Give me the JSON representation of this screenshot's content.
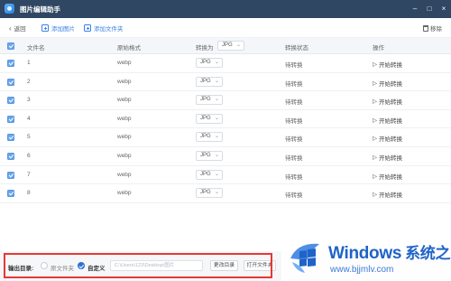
{
  "window": {
    "title": "图片编辑助手",
    "controls": [
      "–",
      "□",
      "×"
    ]
  },
  "toolbar": {
    "back_label": "返回",
    "add_image_label": "添加图片",
    "add_folder_label": "添加文件夹",
    "delete_label": "移除"
  },
  "table": {
    "headers": {
      "filename": "文件名",
      "original_format": "原始格式",
      "convert_to": "转换为",
      "convert_to_value": "JPG",
      "status": "转换状态",
      "action": "操作"
    },
    "rows": [
      {
        "name": "1",
        "format": "webp",
        "target": "JPG",
        "status": "待转换",
        "action": "开始转换"
      },
      {
        "name": "2",
        "format": "webp",
        "target": "JPG",
        "status": "待转换",
        "action": "开始转换"
      },
      {
        "name": "3",
        "format": "webp",
        "target": "JPG",
        "status": "待转换",
        "action": "开始转换"
      },
      {
        "name": "4",
        "format": "webp",
        "target": "JPG",
        "status": "待转换",
        "action": "开始转换"
      },
      {
        "name": "5",
        "format": "webp",
        "target": "JPG",
        "status": "待转换",
        "action": "开始转换"
      },
      {
        "name": "6",
        "format": "webp",
        "target": "JPG",
        "status": "待转换",
        "action": "开始转换"
      },
      {
        "name": "7",
        "format": "webp",
        "target": "JPG",
        "status": "待转换",
        "action": "开始转换"
      },
      {
        "name": "8",
        "format": "webp",
        "target": "JPG",
        "status": "待转换",
        "action": "开始转换"
      }
    ]
  },
  "output": {
    "label": "输出目录:",
    "option_original": "原文件夹",
    "option_custom": "自定义",
    "selected": "custom",
    "path_value": "C:\\Users\\123\\Desktop\\图片",
    "change_dir_label": "更改目录",
    "open_folder_label": "打开文件夹"
  },
  "watermark": {
    "brand": "Windows",
    "brand_cn": "系统之家",
    "url": "www.bjjmlv.com"
  },
  "colors": {
    "titlebar": "#2f4762",
    "accent": "#3b82e6",
    "highlight_border": "#e53935",
    "brand_blue": "#1f63c8"
  }
}
